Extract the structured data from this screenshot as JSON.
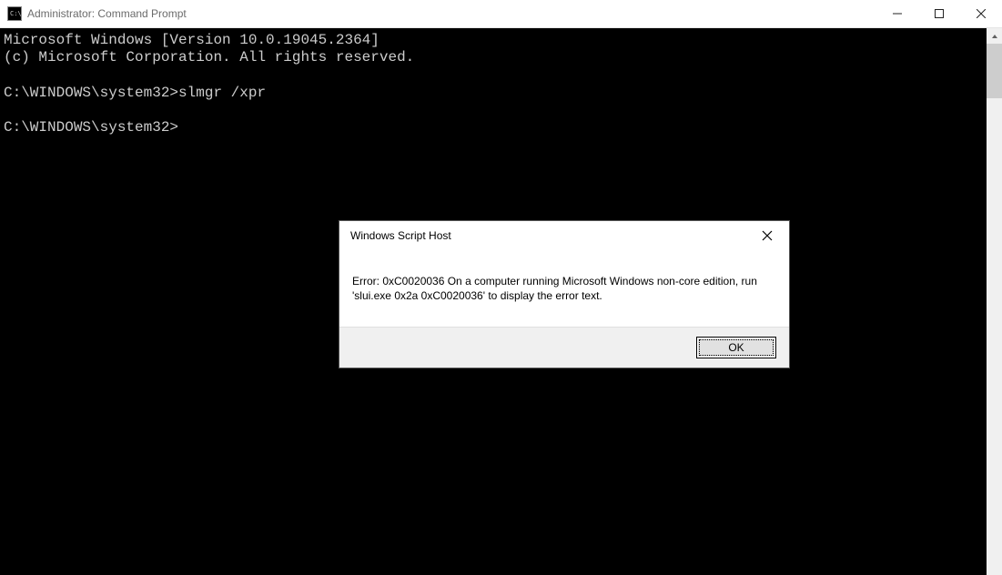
{
  "window": {
    "title": "Administrator: Command Prompt"
  },
  "terminal": {
    "line1": "Microsoft Windows [Version 10.0.19045.2364]",
    "line2": "(c) Microsoft Corporation. All rights reserved.",
    "blank1": "",
    "prompt1": "C:\\WINDOWS\\system32>slmgr /xpr",
    "blank2": "",
    "prompt2": "C:\\WINDOWS\\system32>"
  },
  "dialog": {
    "title": "Windows Script Host",
    "message": "Error: 0xC0020036 On a computer running Microsoft Windows non-core edition, run 'slui.exe 0x2a 0xC0020036' to display the error text.",
    "ok_label": "OK"
  }
}
